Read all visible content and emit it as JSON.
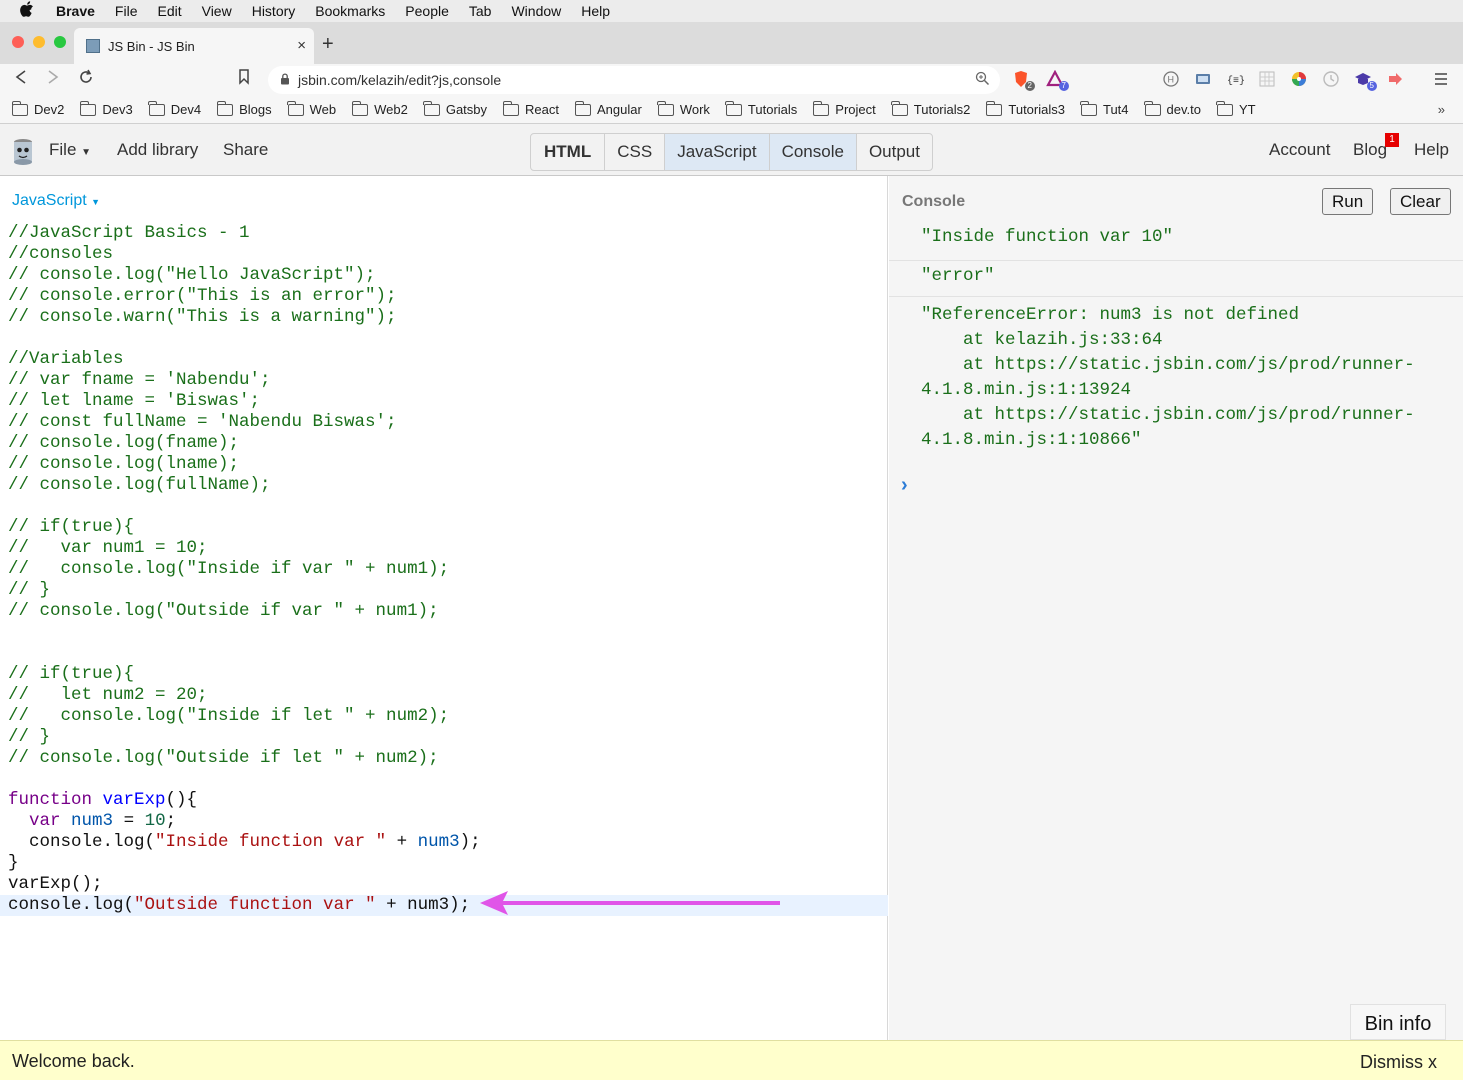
{
  "menubar": {
    "app": "Brave",
    "items": [
      "File",
      "Edit",
      "View",
      "History",
      "Bookmarks",
      "People",
      "Tab",
      "Window",
      "Help"
    ]
  },
  "tab": {
    "title": "JS Bin - JS Bin",
    "close": "×",
    "new": "+"
  },
  "url": "jsbin.com/kelazih/edit?js,console",
  "extensions": {
    "brave_count": "2",
    "rewards_count": "7",
    "ext_count": "5"
  },
  "bookmarks": [
    "Dev2",
    "Dev3",
    "Dev4",
    "Blogs",
    "Web",
    "Web2",
    "Gatsby",
    "React",
    "Angular",
    "Work",
    "Tutorials",
    "Project",
    "Tutorials2",
    "Tutorials3",
    "Tut4",
    "dev.to",
    "YT"
  ],
  "jsbin": {
    "file": "File",
    "add_library": "Add library",
    "share": "Share",
    "panels": [
      "HTML",
      "CSS",
      "JavaScript",
      "Console",
      "Output"
    ],
    "account": "Account",
    "blog": "Blog",
    "blog_badge": "1",
    "help": "Help"
  },
  "editor": {
    "language": "JavaScript",
    "lines": [
      "//JavaScript Basics - 1",
      "//consoles",
      "// console.log(\"Hello JavaScript\");",
      "// console.error(\"This is an error\");",
      "// console.warn(\"This is a warning\");",
      "",
      "//Variables",
      "// var fname = 'Nabendu';",
      "// let lname = 'Biswas';",
      "// const fullName = 'Nabendu Biswas';",
      "// console.log(fname);",
      "// console.log(lname);",
      "// console.log(fullName);",
      "",
      "// if(true){",
      "//   var num1 = 10;",
      "//   console.log(\"Inside if var \" + num1);",
      "// }",
      "// console.log(\"Outside if var \" + num1);",
      "",
      "",
      "// if(true){",
      "//   let num2 = 20;",
      "//   console.log(\"Inside if let \" + num2);",
      "// }",
      "// console.log(\"Outside if let \" + num2);",
      ""
    ],
    "fn": {
      "kw_function": "function",
      "name": "varExp",
      "parens": "(){",
      "kw_var": "var",
      "var_name": "num3",
      "eq": " = ",
      "num": "10",
      "semi": ";",
      "log_open": "console.log(",
      "inside_str": "\"Inside function var \"",
      "plus": " + ",
      "log_close": ");",
      "close_brace": "}",
      "call": "varExp();",
      "outside_str": "\"Outside function var \""
    }
  },
  "console": {
    "title": "Console",
    "run": "Run",
    "clear": "Clear",
    "outputs": [
      [
        "\"Inside function var 10\""
      ],
      [
        "\"error\""
      ],
      [
        "\"ReferenceError: num3 is not defined",
        "    at kelazih.js:33:64",
        "    at https://static.jsbin.com/js/prod/runner-",
        "4.1.8.min.js:1:13924",
        "    at https://static.jsbin.com/js/prod/runner-",
        "4.1.8.min.js:1:10866\""
      ]
    ],
    "prompt": "›",
    "bin_info": "Bin info"
  },
  "welcome": {
    "message": "Welcome back.",
    "dismiss": "Dismiss x"
  },
  "colors": {
    "accent": "#0097db",
    "arrow": "#e055e8",
    "badge": "#e60000"
  }
}
